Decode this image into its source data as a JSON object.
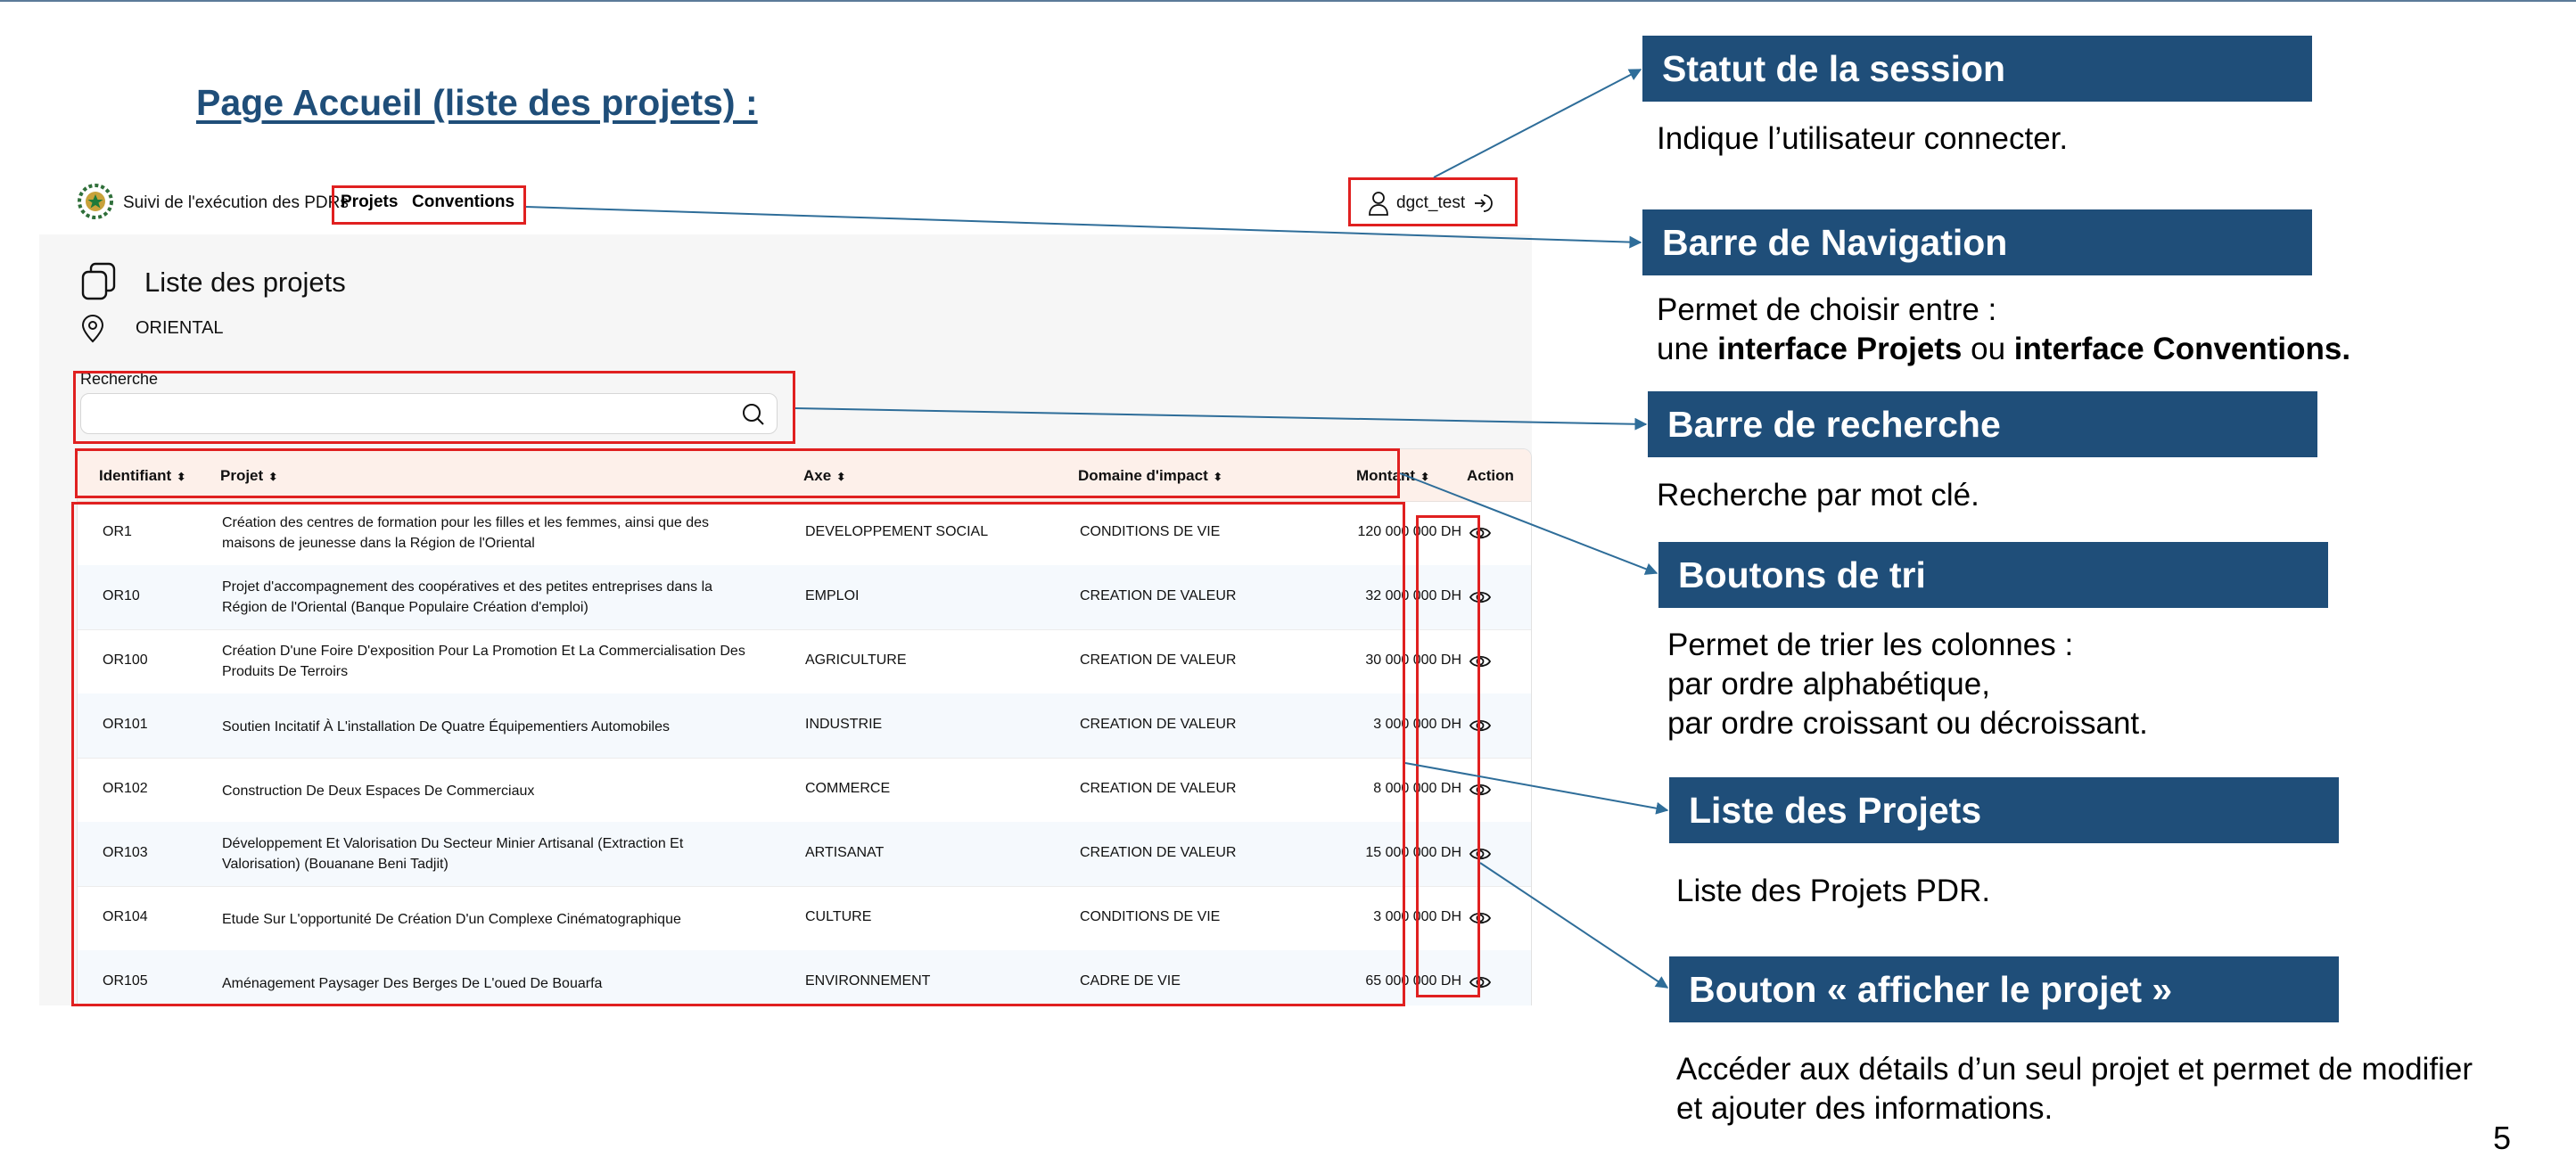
{
  "slide": {
    "title": "Page Accueil (liste des projets) :",
    "page_number": "5"
  },
  "app": {
    "brand": "Suivi de l'exécution des PDRs",
    "nav": {
      "projets": "Projets",
      "conventions": "Conventions"
    },
    "user": "dgct_test",
    "page_title": "Liste des projets",
    "region": "ORIENTAL",
    "search": {
      "label": "Recherche",
      "value": "",
      "placeholder": ""
    },
    "table": {
      "headers": {
        "identifiant": "Identifiant",
        "projet": "Projet",
        "axe": "Axe",
        "domaine": "Domaine d'impact",
        "montant": "Montant",
        "action": "Action"
      },
      "rows": [
        {
          "id": "OR1",
          "projet": "Création des centres de formation pour les filles et les femmes, ainsi que des maisons de jeunesse dans la Région de l'Oriental",
          "axe": "DEVELOPPEMENT SOCIAL",
          "domaine": "CONDITIONS DE VIE",
          "montant": "120 000 000 DH"
        },
        {
          "id": "OR10",
          "projet": "Projet d'accompagnement des coopératives et des petites entreprises dans la Région de l'Oriental (Banque Populaire Création d'emploi)",
          "axe": "EMPLOI",
          "domaine": "CREATION DE VALEUR",
          "montant": "32 000 000 DH"
        },
        {
          "id": "OR100",
          "projet": "Création D'une Foire D'exposition Pour La Promotion Et La Commercialisation Des Produits De Terroirs",
          "axe": "AGRICULTURE",
          "domaine": "CREATION DE VALEUR",
          "montant": "30 000 000 DH"
        },
        {
          "id": "OR101",
          "projet": "Soutien Incitatif À L'installation De Quatre Équipementiers Automobiles",
          "axe": "INDUSTRIE",
          "domaine": "CREATION DE VALEUR",
          "montant": "3 000 000 DH"
        },
        {
          "id": "OR102",
          "projet": "Construction De Deux Espaces De Commerciaux",
          "axe": "COMMERCE",
          "domaine": "CREATION DE VALEUR",
          "montant": "8 000 000 DH"
        },
        {
          "id": "OR103",
          "projet": "Développement Et Valorisation Du Secteur Minier Artisanal (Extraction Et Valorisation) (Bouanane Beni Tadjit)",
          "axe": "ARTISANAT",
          "domaine": "CREATION DE VALEUR",
          "montant": "15 000 000 DH"
        },
        {
          "id": "OR104",
          "projet": "Etude Sur L'opportunité De Création D'un Complexe Cinématographique",
          "axe": "CULTURE",
          "domaine": "CONDITIONS DE VIE",
          "montant": "3 000 000 DH"
        },
        {
          "id": "OR105",
          "projet": "Aménagement Paysager Des Berges De L'oued De Bouarfa",
          "axe": "ENVIRONNEMENT",
          "domaine": "CADRE DE VIE",
          "montant": "65 000 000 DH"
        }
      ]
    }
  },
  "callouts": [
    {
      "title": "Statut de la session",
      "lines": [
        "Indique l’utilisateur connecter."
      ]
    },
    {
      "title": "Barre de Navigation",
      "line1": "Permet de choisir entre :",
      "line2_a": "une ",
      "line2_b": "interface Projets",
      "line2_c": " ou ",
      "line2_d": "interface Conventions."
    },
    {
      "title": "Barre de recherche",
      "lines": [
        "Recherche par mot clé."
      ]
    },
    {
      "title": "Boutons de tri",
      "lines": [
        "Permet de trier les colonnes :",
        "par ordre alphabétique,",
        "par ordre croissant ou décroissant."
      ]
    },
    {
      "title": "Liste des Projets",
      "lines": [
        "Liste des Projets PDR."
      ]
    },
    {
      "title": "Bouton « afficher le projet »",
      "lines": [
        "Accéder aux détails d’un seul projet et permet de modifier",
        "et ajouter des informations."
      ]
    }
  ],
  "colors": {
    "callout_bg": "#1f4e79",
    "highlight": "#e02020",
    "connector": "#2e6d99",
    "table_header_bg": "#fdf0ea"
  }
}
